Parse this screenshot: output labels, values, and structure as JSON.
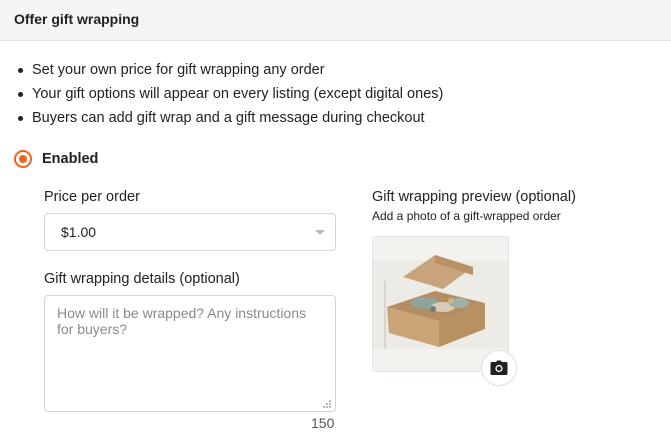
{
  "header": {
    "title": "Offer gift wrapping"
  },
  "bullets": [
    "Set your own price for gift wrapping any order",
    "Your gift options will appear on every listing (except digital ones)",
    "Buyers can add gift wrap and a gift message during checkout"
  ],
  "enabled": {
    "label": "Enabled",
    "selected": true
  },
  "price": {
    "label": "Price per order",
    "value": "$1.00"
  },
  "details": {
    "label": "Gift wrapping details (optional)",
    "placeholder": "How will it be wrapped? Any instructions for buyers?",
    "value": "",
    "remaining": "150"
  },
  "preview": {
    "title": "Gift wrapping preview (optional)",
    "subtitle": "Add a photo of a gift-wrapped order",
    "image_icon": "gift-box-photo",
    "upload_icon": "camera-icon"
  },
  "colors": {
    "accent": "#f1641e",
    "border": "#d5d5d5",
    "header_bg": "#f5f5f5"
  }
}
